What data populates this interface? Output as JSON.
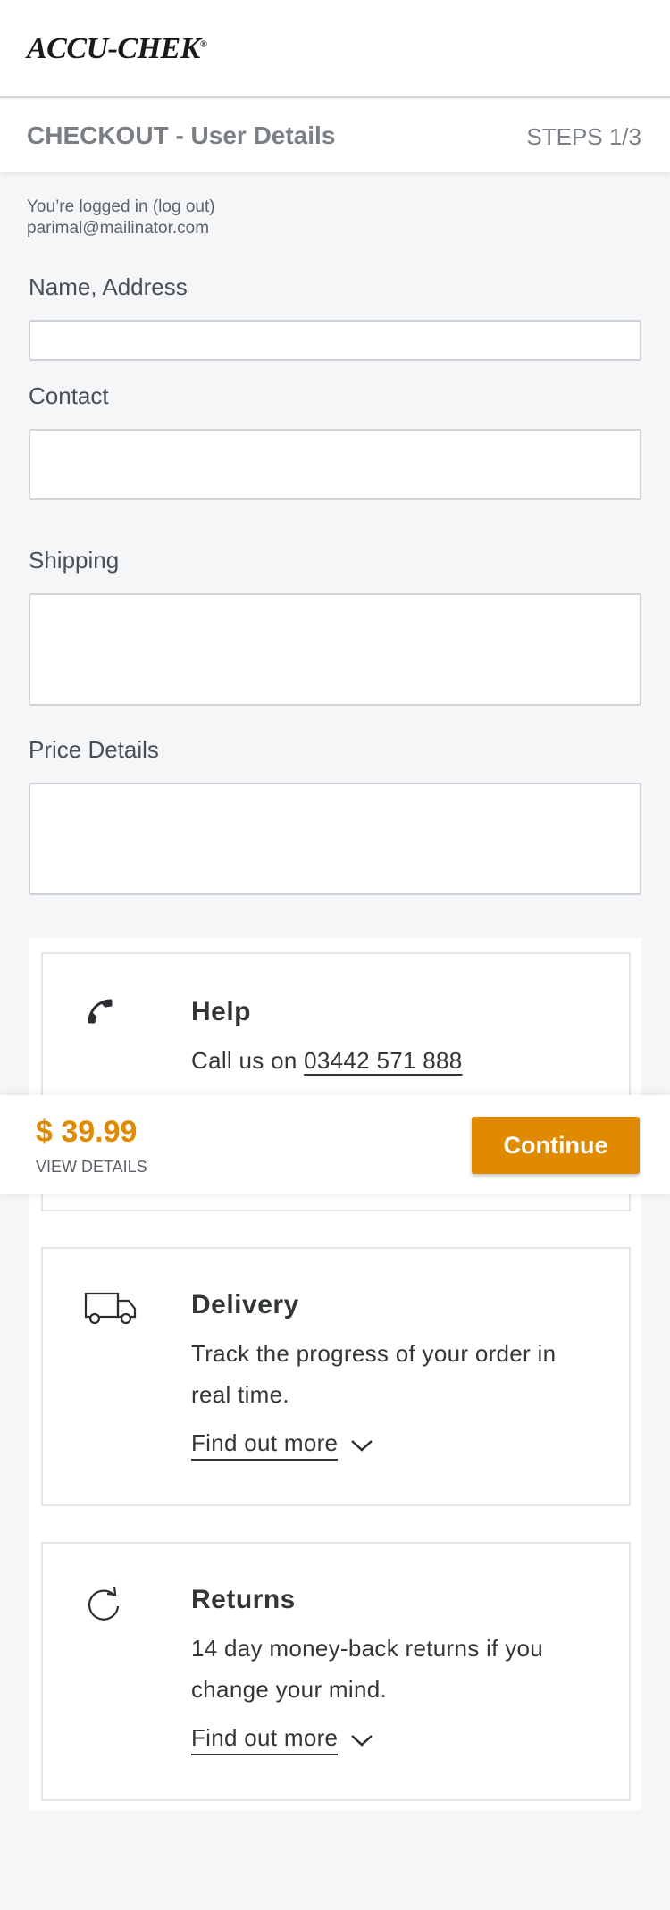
{
  "header": {
    "logo_text": "ACCU-CHEK",
    "logo_mark": "®"
  },
  "checkout": {
    "title": "CHECKOUT - User Details",
    "steps": "STEPS 1/3"
  },
  "account": {
    "login_text": "You’re logged in (log out)",
    "email": "parimal@mailinator.com"
  },
  "sections": {
    "name_address": "Name, Address",
    "contact": "Contact",
    "shipping": "Shipping",
    "price_details": "Price Details"
  },
  "help": {
    "title": "Help",
    "call_prefix": "Call us on ",
    "phone": "03442 571 888",
    "icon": "phone-icon"
  },
  "delivery": {
    "title": "Delivery",
    "text": "Track the progress of your order in real time.",
    "link": "Find out more",
    "icon": "truck-icon"
  },
  "returns": {
    "title": "Returns",
    "text": "14 day money-back returns if you change your mind.",
    "link": "Find out more",
    "icon": "refresh-icon"
  },
  "price_bar": {
    "price": "$ 39.99",
    "view_details": "VIEW DETAILS",
    "continue_label": "Continue"
  },
  "colors": {
    "accent": "#e08a00",
    "background": "#f5f6f8",
    "border": "#cfd2d6"
  }
}
